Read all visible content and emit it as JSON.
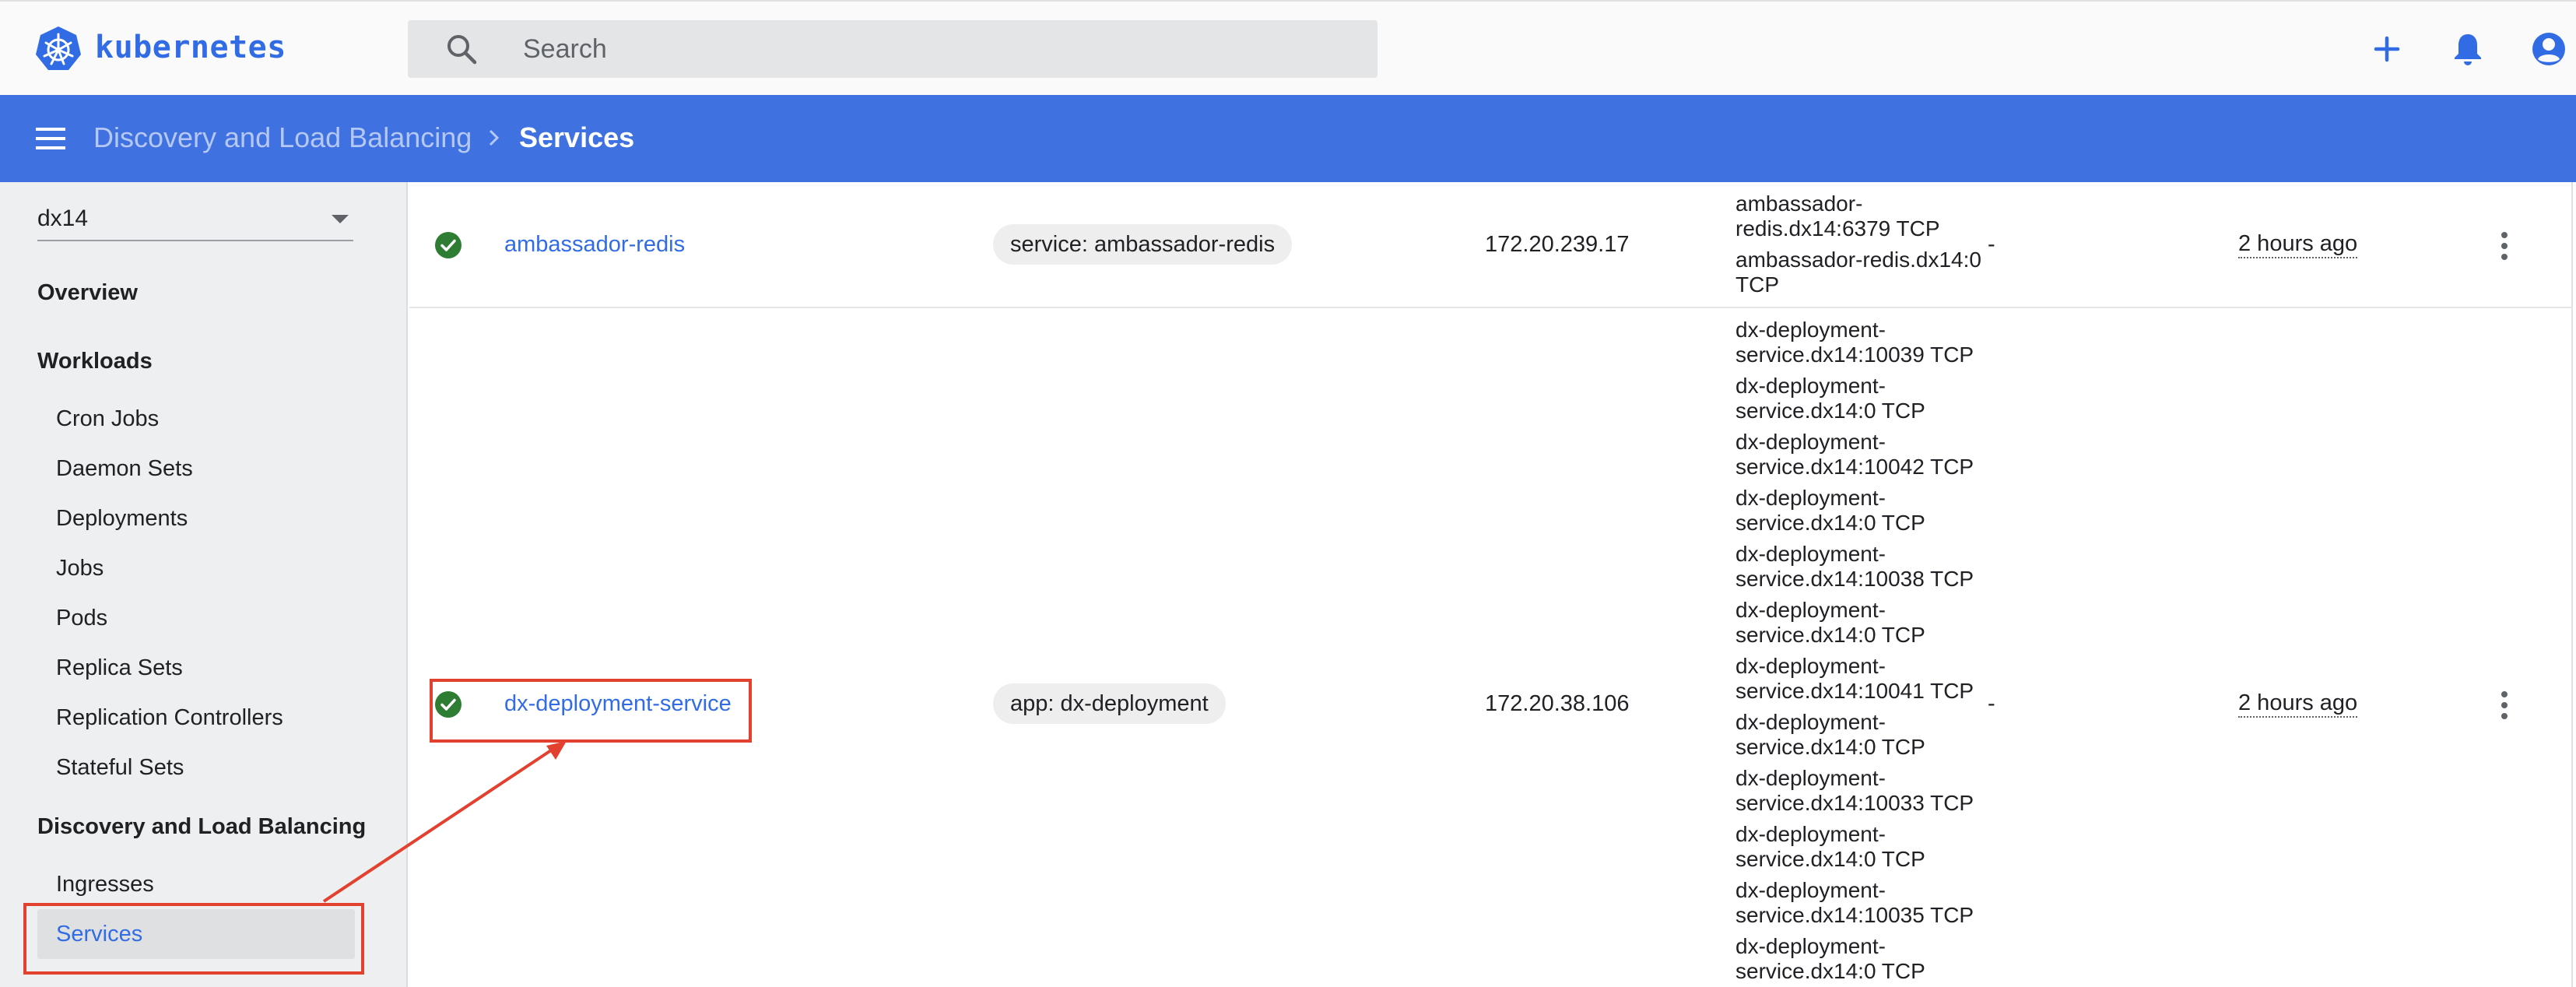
{
  "app": {
    "brand": "kubernetes",
    "accent": "#326ce5",
    "header_color": "#3f71e0"
  },
  "search": {
    "placeholder": "Search"
  },
  "top_actions": [
    "add-icon",
    "bell-icon",
    "account-icon"
  ],
  "breadcrumb": {
    "parent": "Discovery and Load Balancing",
    "current": "Services"
  },
  "sidebar": {
    "namespace": "dx14",
    "overview": "Overview",
    "workloads": {
      "label": "Workloads",
      "items": [
        "Cron Jobs",
        "Daemon Sets",
        "Deployments",
        "Jobs",
        "Pods",
        "Replica Sets",
        "Replication Controllers",
        "Stateful Sets"
      ]
    },
    "discovery": {
      "label": "Discovery and Load Balancing",
      "items": [
        "Ingresses",
        "Services"
      ],
      "active": "Services"
    }
  },
  "services": [
    {
      "status": "check-circle-icon",
      "name": "ambassador-redis",
      "label": "service: ambassador-redis",
      "cluster_ip": "172.20.239.17",
      "endpoints": [
        "ambassador-redis.dx14:6379 TCP",
        "ambassador-redis.dx14:0 TCP"
      ],
      "external": "-",
      "age": "2 hours ago"
    },
    {
      "status": "check-circle-icon",
      "name": "dx-deployment-service",
      "label": "app: dx-deployment",
      "cluster_ip": "172.20.38.106",
      "endpoints": [
        "dx-deployment-service.dx14:10039 TCP",
        "dx-deployment-service.dx14:0 TCP",
        "dx-deployment-service.dx14:10042 TCP",
        "dx-deployment-service.dx14:0 TCP",
        "dx-deployment-service.dx14:10038 TCP",
        "dx-deployment-service.dx14:0 TCP",
        "dx-deployment-service.dx14:10041 TCP",
        "dx-deployment-service.dx14:0 TCP",
        "dx-deployment-service.dx14:10033 TCP",
        "dx-deployment-service.dx14:0 TCP",
        "dx-deployment-service.dx14:10035 TCP",
        "dx-deployment-service.dx14:0 TCP"
      ],
      "external": "-",
      "age": "2 hours ago"
    }
  ],
  "annotation": {
    "color": "#e3412f"
  }
}
